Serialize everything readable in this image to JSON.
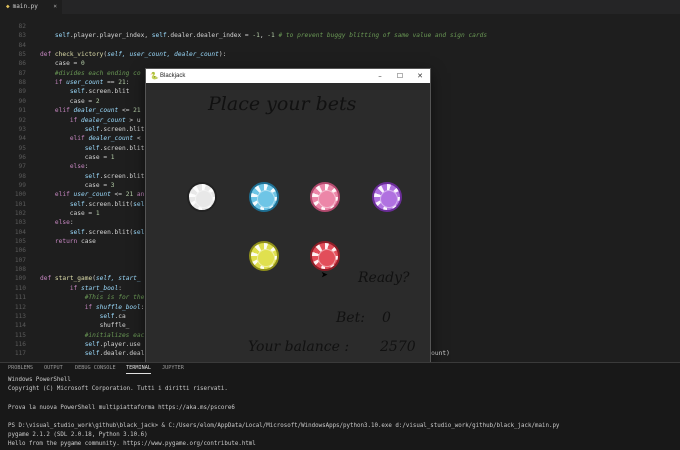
{
  "editor": {
    "tab_label": "main.py",
    "lines": [
      {
        "n": "82",
        "html": ""
      },
      {
        "n": "83",
        "html": "    <span class='sf'>self</span>.player.player_index, <span class='sf'>self</span>.dealer.dealer_index = <span class='nm'>-1</span>, <span class='nm'>-1</span> <span class='cm'># to prevent buggy blitting of same value and sign cards</span>"
      },
      {
        "n": "84",
        "html": ""
      },
      {
        "n": "85",
        "html": "<span class='kw'>def</span> <span class='fn'>check_victory</span>(<span class='it'>self, user_count, dealer_count</span>):"
      },
      {
        "n": "86",
        "html": "    case = <span class='nm'>0</span>"
      },
      {
        "n": "87",
        "html": "    <span class='cm'>#divides each ending co</span>"
      },
      {
        "n": "88",
        "html": "    <span class='kw'>if</span> <span class='it'>user_count</span> == <span class='nm'>21</span>:"
      },
      {
        "n": "89",
        "html": "        <span class='sf'>self</span>.screen.blit"
      },
      {
        "n": "90",
        "html": "        case = <span class='nm'>2</span>"
      },
      {
        "n": "91",
        "html": "    <span class='kw'>elif</span> <span class='it'>dealer_count</span> &lt;= <span class='nm'>21</span>"
      },
      {
        "n": "92",
        "html": "        <span class='kw'>if</span> <span class='it'>dealer_count</span> &gt; u"
      },
      {
        "n": "93",
        "html": "            <span class='sf'>self</span>.screen.blit"
      },
      {
        "n": "94",
        "html": "        <span class='kw'>elif</span> <span class='it'>dealer_count</span> &lt;"
      },
      {
        "n": "95",
        "html": "            <span class='sf'>self</span>.screen.blit"
      },
      {
        "n": "96",
        "html": "            case = <span class='nm'>1</span>"
      },
      {
        "n": "97",
        "html": "        <span class='kw'>else</span>:"
      },
      {
        "n": "98",
        "html": "            <span class='sf'>self</span>.screen.blit"
      },
      {
        "n": "99",
        "html": "            case = <span class='nm'>3</span>"
      },
      {
        "n": "100",
        "html": "    <span class='kw'>elif</span> <span class='it'>user_count</span> &lt;= <span class='nm'>21</span> <span class='kw'>an</span>"
      },
      {
        "n": "101",
        "html": "        <span class='sf'>self</span>.screen.blit(<span class='sf'>sel</span>"
      },
      {
        "n": "102",
        "html": "        case = <span class='nm'>1</span>"
      },
      {
        "n": "103",
        "html": "    <span class='kw'>else</span>:"
      },
      {
        "n": "104",
        "html": "        <span class='sf'>self</span>.screen.blit(<span class='sf'>sel</span>"
      },
      {
        "n": "105",
        "html": "    <span class='kw'>return</span> case"
      },
      {
        "n": "106",
        "html": ""
      },
      {
        "n": "107",
        "html": ""
      },
      {
        "n": "108",
        "html": ""
      },
      {
        "n": "109",
        "html": "<span class='kw'>def</span> <span class='fn'>start_game</span>(<span class='it'>self, start_</span>"
      },
      {
        "n": "110",
        "html": "        <span class='kw'>if</span> <span class='it'>start_bool</span>:"
      },
      {
        "n": "111",
        "html": "            <span class='cm'>#This is for the</span>"
      },
      {
        "n": "112",
        "html": "            <span class='kw'>if</span> <span class='it'>shuffle_bool</span>:"
      },
      {
        "n": "113",
        "html": "                <span class='sf'>self</span>.ca"
      },
      {
        "n": "114",
        "html": "                shuffle_"
      },
      {
        "n": "115",
        "html": "            <span class='cm'>#initializes eac</span>"
      },
      {
        "n": "116",
        "html": "            <span class='sf'>self</span>.player.use                                                          <span class='sf'>player</span>.user_count)"
      },
      {
        "n": "117",
        "html": "            <span class='sf'>self</span>.dealer.deal                                                         <span class='sf'>self</span>.dealer.dealer_count)"
      }
    ]
  },
  "panel": {
    "tabs": [
      "PROBLEMS",
      "OUTPUT",
      "DEBUG CONSOLE",
      "TERMINAL",
      "JUPYTER"
    ],
    "active_tab": "TERMINAL",
    "terminal_lines": [
      "Windows PowerShell",
      "Copyright (C) Microsoft Corporation. Tutti i diritti riservati.",
      "",
      "Prova la nuova PowerShell multipiattaforma https://aka.ms/pscore6",
      "",
      "PS D:\\visual_studio_work\\github\\black_jack> & C:/Users/elom/AppData/Local/Microsoft/WindowsApps/python3.10.exe d:/visual_studio_work/github/black_jack/main.py",
      "pygame 2.1.2 (SDL 2.0.18, Python 3.10.6)",
      "Hello from the pygame community. https://www.pygame.org/contribute.html"
    ]
  },
  "window": {
    "title": "Blackjack",
    "icon": "pygame-snake-icon",
    "minimize": "–",
    "maximize": "☐",
    "close": "✕"
  },
  "game": {
    "heading": "Place your bets",
    "ready_label": "Ready?",
    "bet_label": "Bet:",
    "bet_value": "0",
    "balance_label": "Your balance :",
    "balance_value": "2570",
    "chips": [
      {
        "name": "white-chip",
        "color": "#e8e8e8",
        "rim": "#222222"
      },
      {
        "name": "blue-chip",
        "color": "#6ec5e6",
        "rim": "#1e6f93"
      },
      {
        "name": "pink-chip",
        "color": "#ec86a8",
        "rim": "#b24a6e"
      },
      {
        "name": "purple-chip",
        "color": "#b071e0",
        "rim": "#6a2d97"
      },
      {
        "name": "yellow-chip",
        "color": "#e0e04e",
        "rim": "#8f8f1a"
      },
      {
        "name": "red-chip",
        "color": "#e24e5a",
        "rim": "#8e1d27"
      }
    ]
  }
}
